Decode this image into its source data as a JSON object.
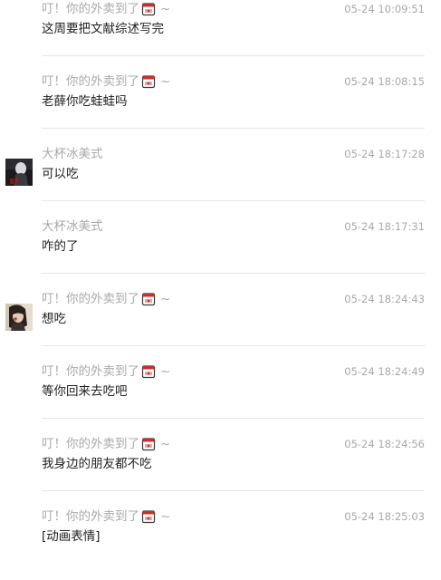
{
  "messages": [
    {
      "sender": "叮！你的外卖到了",
      "sender_emoji": "takeout-box-icon",
      "sender_suffix": "~",
      "time": "05-24 10:09:51",
      "text": "这周要把文献综述写完",
      "avatar": null
    },
    {
      "sender": "叮！你的外卖到了",
      "sender_emoji": "takeout-box-icon",
      "sender_suffix": "~",
      "time": "05-24 18:08:15",
      "text": "老薛你吃蛙蛙吗",
      "avatar": null
    },
    {
      "sender": "大杯冰美式",
      "sender_emoji": null,
      "sender_suffix": "",
      "time": "05-24 18:17:28",
      "text": "可以吃",
      "avatar": "dark-figure-avatar"
    },
    {
      "sender": "大杯冰美式",
      "sender_emoji": null,
      "sender_suffix": "",
      "time": "05-24 18:17:31",
      "text": "咋的了",
      "avatar": null
    },
    {
      "sender": "叮！你的外卖到了",
      "sender_emoji": "takeout-box-icon",
      "sender_suffix": "~",
      "time": "05-24 18:24:43",
      "text": "想吃",
      "avatar": "girl-photo-avatar"
    },
    {
      "sender": "叮！你的外卖到了",
      "sender_emoji": "takeout-box-icon",
      "sender_suffix": "~",
      "time": "05-24 18:24:49",
      "text": "等你回来去吃吧",
      "avatar": null
    },
    {
      "sender": "叮！你的外卖到了",
      "sender_emoji": "takeout-box-icon",
      "sender_suffix": "~",
      "time": "05-24 18:24:56",
      "text": "我身边的朋友都不吃",
      "avatar": null
    },
    {
      "sender": "叮！你的外卖到了",
      "sender_emoji": "takeout-box-icon",
      "sender_suffix": "~",
      "time": "05-24 18:25:03",
      "text": "[动画表情]",
      "avatar": null
    }
  ],
  "colors": {
    "name": "#a9a9a9",
    "time": "#a9a9a9",
    "text": "#222222",
    "divider": "#e6e6e6"
  }
}
